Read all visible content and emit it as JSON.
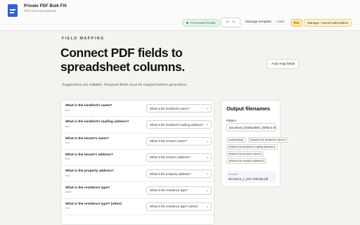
{
  "app": {
    "title": "Private PDF Bulk Fill",
    "subtitle": "PDFs from spreadsheets"
  },
  "header": {
    "status": "Processed locally",
    "undo_icon": "undo-icon",
    "redo_icon": "redo-icon",
    "undo_glyph": "↶",
    "redo_glyph": "↷",
    "manage_template": "Manage template",
    "new_label": "+ New",
    "pro_label": "Pro",
    "subscription_label": "Manage / cancel subscription"
  },
  "page": {
    "eyebrow": "FIELD MAPPING",
    "heading": "Connect PDF fields to spreadsheet columns.",
    "automap_label": "Auto-map fields",
    "hint": "Suggestions are editable. Required fields must be mapped before generation."
  },
  "mapping": {
    "rows": [
      {
        "label": "What is the landlord's name?",
        "type": "text",
        "selected": "What is the landlord's name?"
      },
      {
        "label": "What is the landlord's mailing address?",
        "type": "text",
        "selected": "What is the landlord's mailing address?"
      },
      {
        "label": "What is the tenant's name?",
        "type": "text",
        "selected": "What is the tenant's name?"
      },
      {
        "label": "What is the tenant's address?",
        "type": "text",
        "selected": "What is the tenant's address?"
      },
      {
        "label": "What is the property address?",
        "type": "text",
        "selected": "What is the property address?"
      },
      {
        "label": "What is the residence type?",
        "type": "radio",
        "selected": "What is the residence type?"
      },
      {
        "label": "What is the residence type? (other)",
        "type": "text",
        "selected": "What is the residence type? (other)"
      }
    ]
  },
  "output": {
    "title": "Output filenames",
    "pattern_label": "Pattern",
    "pattern_value": "document_{rowNumber}_{What is the tenar",
    "chips": [
      "{rowNumber}",
      "{What is the landlord's name?}",
      "{What is the landlord's mailing address?}",
      "{What is the tenant's name?}",
      "{What is the tenant's address?}"
    ],
    "preview_label": "Example",
    "preview_value": "document_1_Alex Testman.pdf"
  },
  "colors": {
    "accent": "#2f5fe3",
    "status_green": "#2e7a46",
    "pro_yellow": "#fde9a6",
    "background": "#f4f3ef"
  }
}
